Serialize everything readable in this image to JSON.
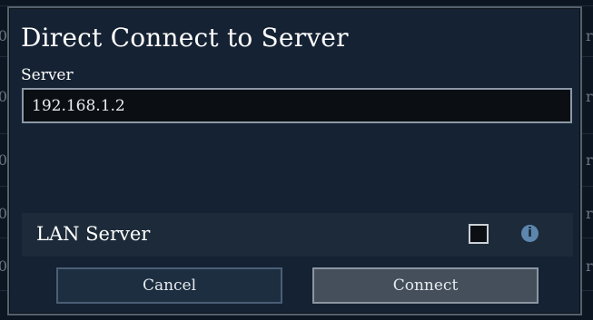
{
  "dialog": {
    "title": "Direct Connect to Server",
    "server_label": "Server",
    "server_value": "192.168.1.2",
    "lan_label": "LAN Server",
    "lan_checked": false,
    "info_glyph": "i",
    "cancel_label": "Cancel",
    "connect_label": "Connect"
  },
  "background": {
    "left_edge_chars": [
      "0",
      "0",
      "0",
      "0",
      "0",
      "0"
    ],
    "right_edge_chars": [
      "ra",
      "ra",
      "ra",
      "ra",
      "ra",
      "ra"
    ]
  },
  "icons": {
    "info": "info-icon"
  },
  "colors": {
    "modal_bg": "#152233",
    "modal_border": "#55606d",
    "input_bg": "#0b0f14",
    "info_icon": "#5d86ad",
    "connect_bg": "#444f5b",
    "cancel_bg": "#1d2e41"
  }
}
